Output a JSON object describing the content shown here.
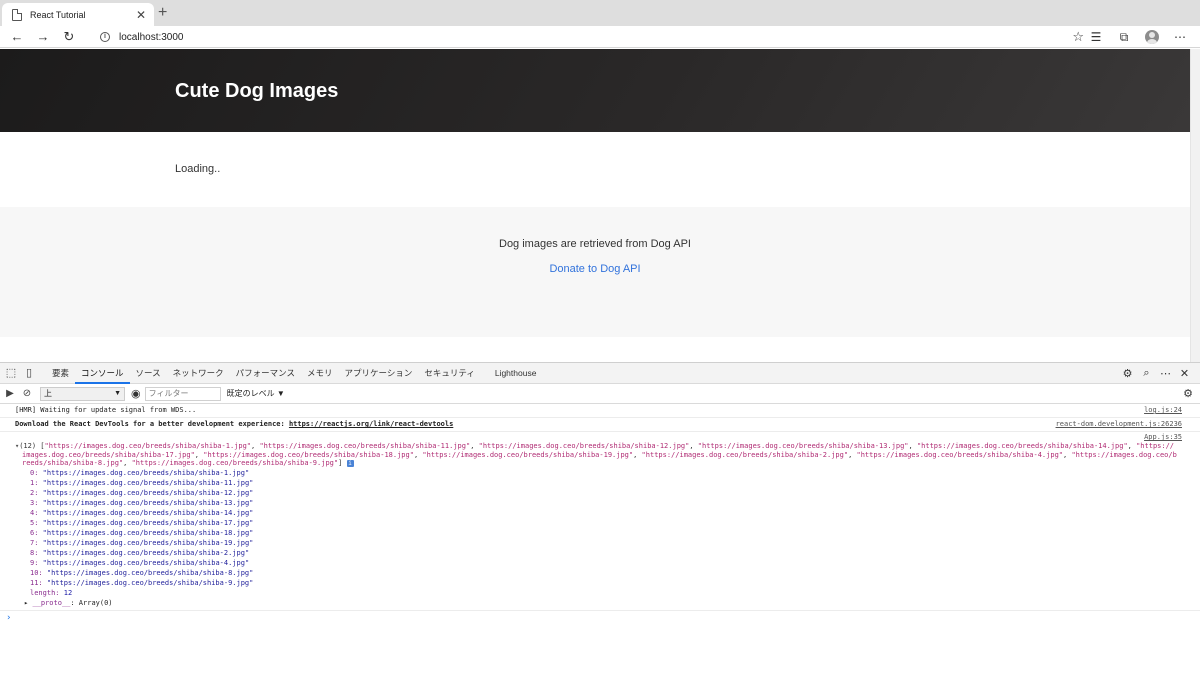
{
  "browser": {
    "tab_title": "React Tutorial",
    "new_tab_label": "+",
    "url": "localhost:3000"
  },
  "page": {
    "hero_title": "Cute Dog Images",
    "loading_text": "Loading..",
    "footer_text": "Dog images are retrieved from Dog API",
    "footer_link": "Donate to Dog API"
  },
  "devtools": {
    "tabs": [
      "要素",
      "コンソール",
      "ソース",
      "ネットワーク",
      "パフォーマンス",
      "メモリ",
      "アプリケーション",
      "セキュリティ",
      "Lighthouse"
    ],
    "active_tab": "コンソール",
    "context_select": "上",
    "filter_placeholder": "フィルター",
    "level_select": "既定のレベル ▼"
  },
  "console": {
    "line1": {
      "text": "[HMR] Waiting for update signal from WDS...",
      "source": "log.js:24"
    },
    "line2": {
      "text": "Download the React DevTools for a better development experience: ",
      "link": "https://reactjs.org/link/react-devtools",
      "source": "react-dom.development.js:26236"
    },
    "array": {
      "source": "App.js:35",
      "header_prefix": "(12) [",
      "header_items": [
        "\"https://images.dog.ceo/breeds/shiba/shiba-1.jpg\"",
        "\"https://images.dog.ceo/breeds/shiba/shiba-11.jpg\"",
        "\"https://images.dog.ceo/breeds/shiba/shiba-12.jpg\"",
        "\"https://images.dog.ceo/breeds/shiba/shiba-13.jpg\"",
        "\"https://images.dog.ceo/breeds/shiba/shiba-14.jpg\"",
        "\"https://images.dog.ceo/breeds/shiba/shiba-17.jpg\"",
        "\"https://images.dog.ceo/breeds/shiba/shiba-18.jpg\"",
        "\"https://images.dog.ceo/breeds/shiba/shiba-19.jpg\"",
        "\"https://images.dog.ceo/breeds/shiba/shiba-2.jpg\"",
        "\"https://images.dog.ceo/breeds/shiba/shiba-4.jpg\"",
        "\"https://images.dog.ceo/breeds/shiba/shiba-8.jpg\"",
        "\"https://images.dog.ceo/breeds/shiba/shiba-9.jpg\""
      ],
      "header_suffix": "]",
      "items": [
        {
          "index": "0:",
          "value": "\"https://images.dog.ceo/breeds/shiba/shiba-1.jpg\""
        },
        {
          "index": "1:",
          "value": "\"https://images.dog.ceo/breeds/shiba/shiba-11.jpg\""
        },
        {
          "index": "2:",
          "value": "\"https://images.dog.ceo/breeds/shiba/shiba-12.jpg\""
        },
        {
          "index": "3:",
          "value": "\"https://images.dog.ceo/breeds/shiba/shiba-13.jpg\""
        },
        {
          "index": "4:",
          "value": "\"https://images.dog.ceo/breeds/shiba/shiba-14.jpg\""
        },
        {
          "index": "5:",
          "value": "\"https://images.dog.ceo/breeds/shiba/shiba-17.jpg\""
        },
        {
          "index": "6:",
          "value": "\"https://images.dog.ceo/breeds/shiba/shiba-18.jpg\""
        },
        {
          "index": "7:",
          "value": "\"https://images.dog.ceo/breeds/shiba/shiba-19.jpg\""
        },
        {
          "index": "8:",
          "value": "\"https://images.dog.ceo/breeds/shiba/shiba-2.jpg\""
        },
        {
          "index": "9:",
          "value": "\"https://images.dog.ceo/breeds/shiba/shiba-4.jpg\""
        },
        {
          "index": "10:",
          "value": "\"https://images.dog.ceo/breeds/shiba/shiba-8.jpg\""
        },
        {
          "index": "11:",
          "value": "\"https://images.dog.ceo/breeds/shiba/shiba-9.jpg\""
        }
      ],
      "length_key": "length:",
      "length_value": "12",
      "proto_key": "__proto__",
      "proto_value": ": Array(0)"
    },
    "prompt": "›"
  }
}
